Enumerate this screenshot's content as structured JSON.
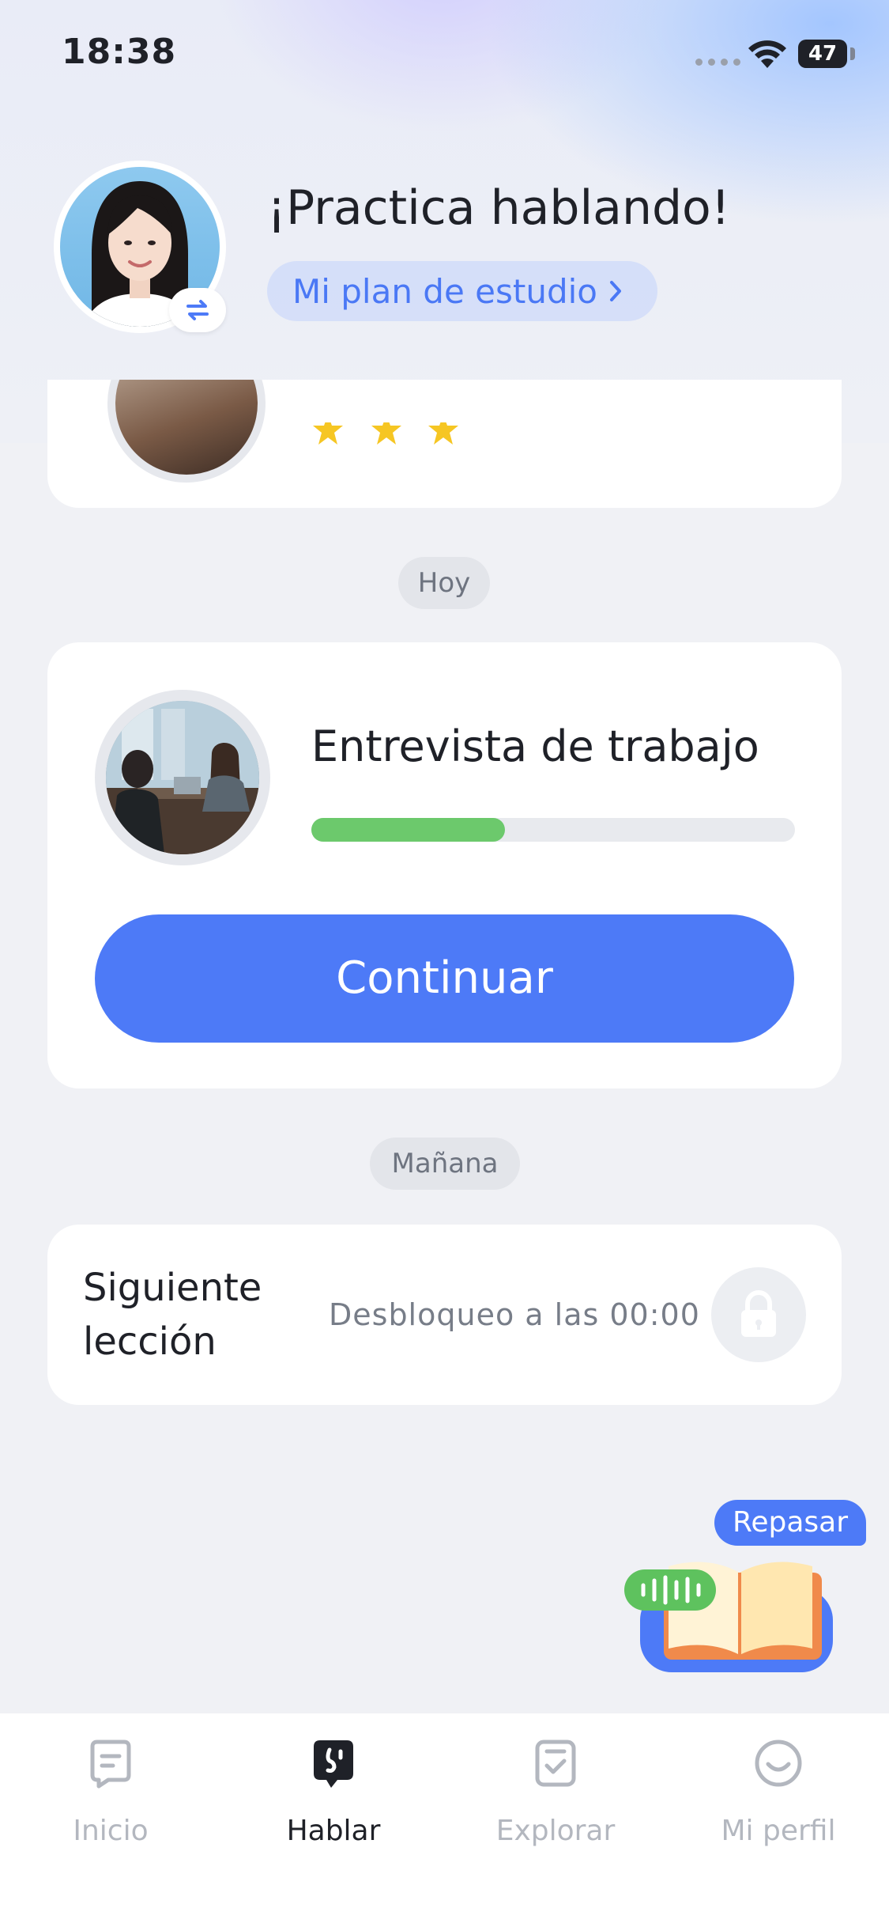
{
  "status_bar": {
    "time": "18:38",
    "battery": "47"
  },
  "header": {
    "title": "¡Practica hablando!",
    "plan_link": "Mi plan de estudio"
  },
  "sections": {
    "today_label": "Hoy",
    "tomorrow_label": "Mañana"
  },
  "today_lesson": {
    "title": "Entrevista de trabajo",
    "progress_fraction": 0.4,
    "button_label": "Continuar"
  },
  "next_lesson": {
    "title": "Siguiente lección",
    "unlock_text": "Desbloqueo a las 00:00"
  },
  "review": {
    "label": "Repasar"
  },
  "tabs": [
    {
      "label": "Inicio",
      "icon": "notes-icon",
      "active": false
    },
    {
      "label": "Hablar",
      "icon": "speech-bubble-icon",
      "active": true
    },
    {
      "label": "Explorar",
      "icon": "checklist-icon",
      "active": false
    },
    {
      "label": "Mi perfil",
      "icon": "smiley-icon",
      "active": false
    }
  ],
  "colors": {
    "accent": "#4d7af7",
    "progress": "#6cc96c",
    "star": "#f6c623"
  }
}
